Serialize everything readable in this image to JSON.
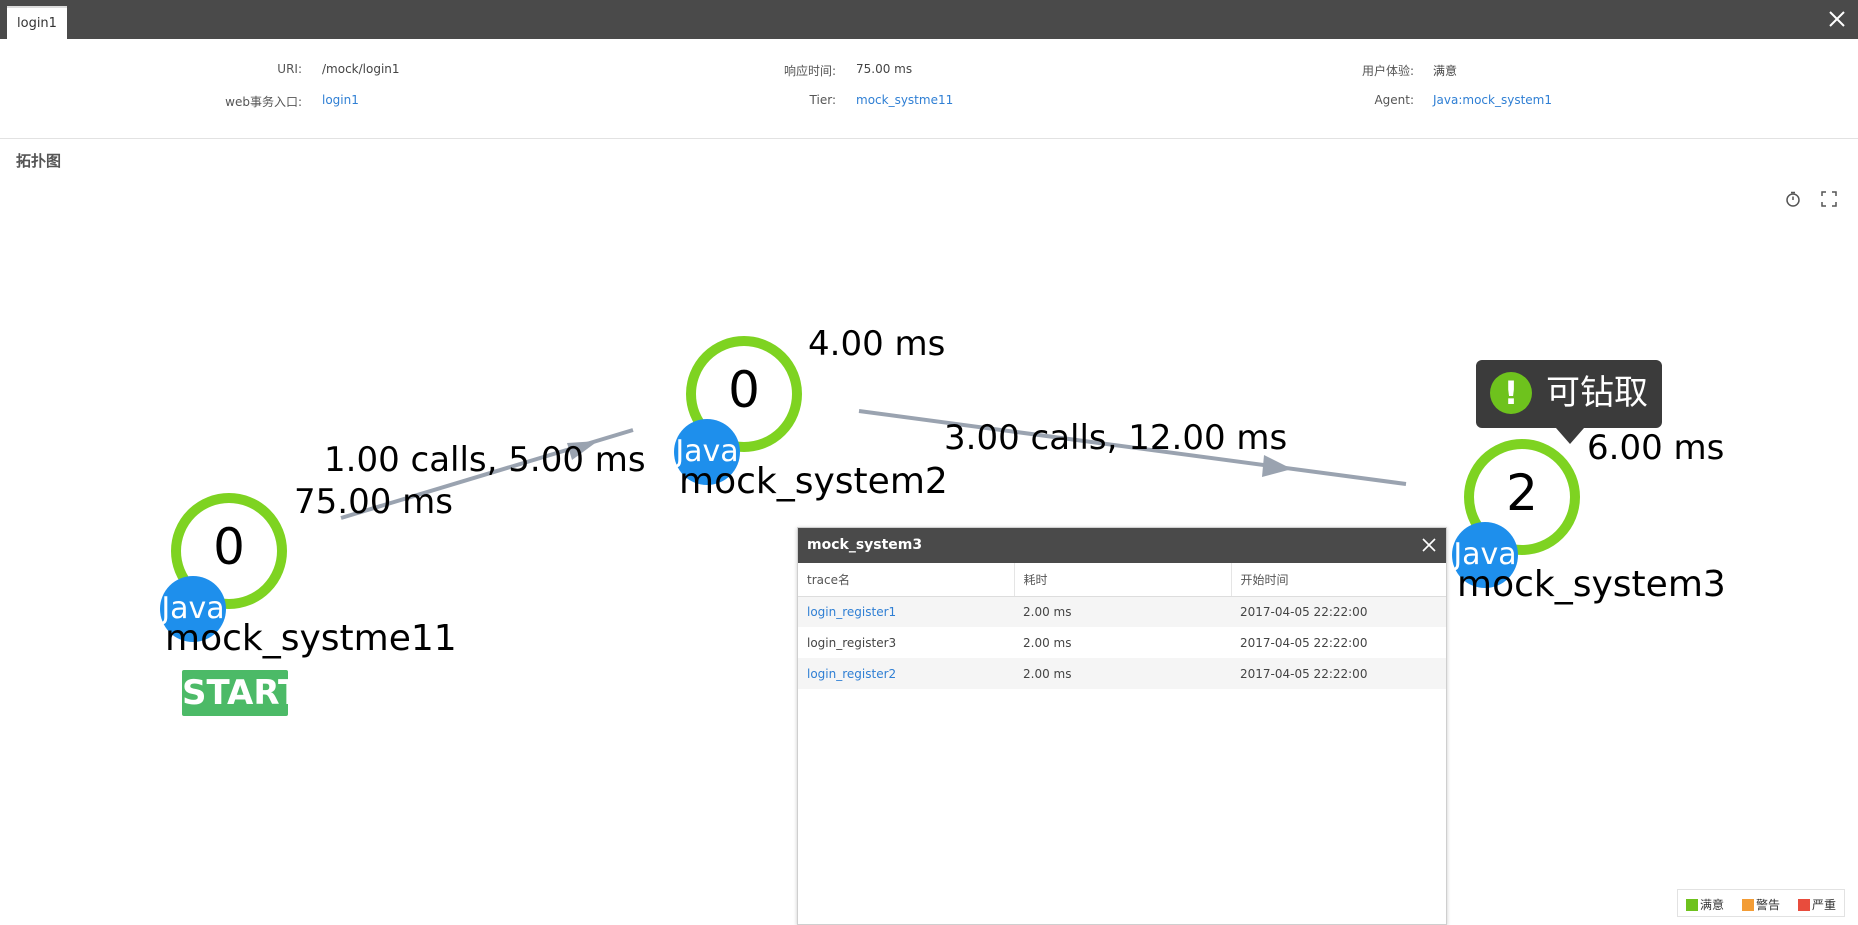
{
  "tab": {
    "label": "login1"
  },
  "info": {
    "uri_label": "URI:",
    "uri_value": "/mock/login1",
    "entry_label": "web事务入口:",
    "entry_value": "login1",
    "resp_label": "响应时间:",
    "resp_value": "75.00 ms",
    "tier_label": "Tier:",
    "tier_value": "mock_systme11",
    "ux_label": "用户体验:",
    "ux_value": "满意",
    "agent_label": "Agent:",
    "agent_value": "Java:mock_system1"
  },
  "section_title": "拓扑图",
  "graph": {
    "nodes": [
      {
        "name": "mock_systme11",
        "count": "0",
        "tech": "Java",
        "time": "75.00 ms",
        "badge": "START"
      },
      {
        "name": "mock_system2",
        "count": "0",
        "tech": "Java",
        "time": "4.00 ms"
      },
      {
        "name": "mock_system3",
        "count": "2",
        "tech": "Java",
        "time": "6.00 ms"
      }
    ],
    "edges": [
      {
        "label": "1.00 calls, 5.00 ms"
      },
      {
        "label": "3.00 calls, 12.00 ms"
      }
    ],
    "tooltip": "可钻取"
  },
  "panel": {
    "title": "mock_system3",
    "columns": [
      "trace名",
      "耗时",
      "开始时间"
    ],
    "rows": [
      {
        "trace": "login_register1",
        "duration": "2.00 ms",
        "start": "2017-04-05 22:22:00",
        "link": true
      },
      {
        "trace": "login_register3",
        "duration": "2.00 ms",
        "start": "2017-04-05 22:22:00",
        "link": false
      },
      {
        "trace": "login_register2",
        "duration": "2.00 ms",
        "start": "2017-04-05 22:22:00",
        "link": true
      }
    ]
  },
  "legend": [
    {
      "label": "满意",
      "color": "#6ec21d"
    },
    {
      "label": "警告",
      "color": "#f39c35"
    },
    {
      "label": "严重",
      "color": "#e84c3d"
    }
  ],
  "colors": {
    "ring": "#7ed321",
    "java": "#1e8fec",
    "edge": "#9aa3b0",
    "link": "#2f7fd4"
  }
}
